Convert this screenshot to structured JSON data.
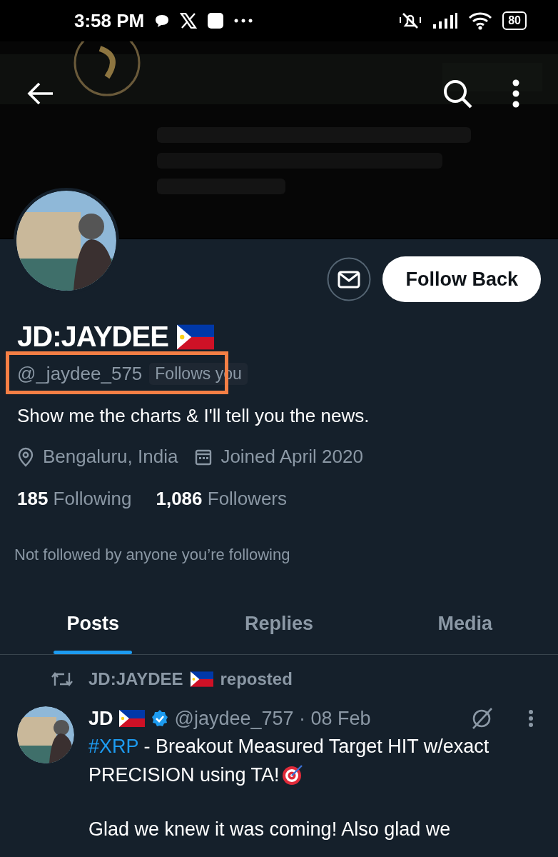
{
  "status_bar": {
    "time": "3:58 PM",
    "battery": "80"
  },
  "profile": {
    "name": "JD:JAYDEE",
    "handle": "@_jaydee_575",
    "follows_badge": "Follows you",
    "bio": "Show me the charts & I'll tell you the news.",
    "location": "Bengaluru, India",
    "joined": "Joined April 2020",
    "following_count": "185",
    "following_label": "Following",
    "followers_count": "1,086",
    "followers_label": "Followers",
    "mutuals_note": "Not followed by anyone you’re following",
    "follow_button": "Follow Back"
  },
  "tabs": [
    {
      "label": "Posts",
      "selected": true
    },
    {
      "label": "Replies",
      "selected": false
    },
    {
      "label": "Media",
      "selected": false
    }
  ],
  "posts": [
    {
      "repost_by": "JD:JAYDEE",
      "repost_label": "reposted",
      "author": "JD",
      "verified": true,
      "handle_date": "@jaydee_757 · 08 Feb",
      "hashtag": "#XRP",
      "text": " - Breakout Measured Target HIT w/exact",
      "text_cont": "PRECISION using TA!",
      "text_2": "Glad we knew it was coming! Also glad we"
    }
  ]
}
